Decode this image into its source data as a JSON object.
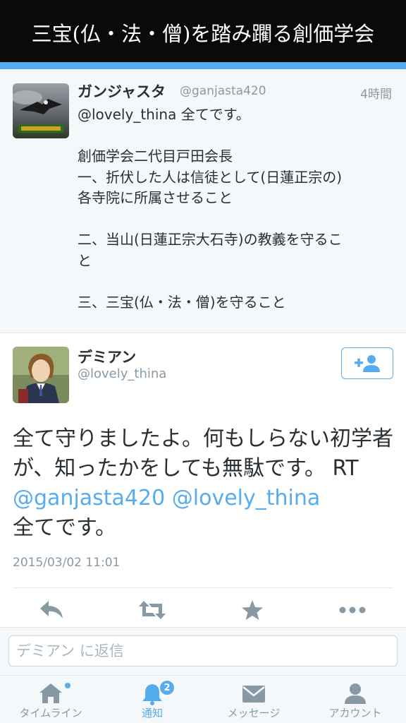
{
  "banner": {
    "title": "三宝(仏・法・僧)を踏み躙る創価学会"
  },
  "parent_tweet": {
    "name": "ガンジャスタ",
    "handle": "@ganjasta420",
    "time": "4時間",
    "text": "@lovely_thina 全てです。\n\n創価学会二代目戸田会長\n一、折伏した人は信徒として(日蓮正宗の)\n各寺院に所属させること\n\n二、当山(日蓮正宗大石寺)の教義を守るこ\nと\n\n三、三宝(仏・法・僧)を守ること",
    "avatar_icon": "eagle-avatar-icon"
  },
  "main_tweet": {
    "name": "デミアン",
    "handle": "@lovely_thina",
    "avatar_icon": "portrait-avatar-icon",
    "follow_icon": "follow-person-plus-icon",
    "text_part1": "全て守りましたよ。何もしらない初学者が、知ったかをしても無駄です。 RT ",
    "mention1": "@ganjasta420",
    "mention2": "@lovely_thina",
    "text_part2": "全てです。",
    "date": "2015/03/02 11:01"
  },
  "actions": {
    "reply_icon": "reply-icon",
    "retweet_icon": "retweet-icon",
    "favorite_icon": "star-icon",
    "more_icon": "more-dots-icon"
  },
  "reply": {
    "placeholder": "デミアン に返信"
  },
  "tabbar": {
    "tabs": [
      {
        "label": "タイムライン",
        "icon": "home-icon"
      },
      {
        "label": "通知",
        "icon": "bell-icon",
        "badge": "2"
      },
      {
        "label": "メッセージ",
        "icon": "envelope-icon"
      },
      {
        "label": "アカウント",
        "icon": "person-icon"
      }
    ]
  },
  "colors": {
    "accent": "#55acee",
    "banner_bg": "#0a0a0a",
    "muted": "#8899a6",
    "text": "#292f33"
  }
}
